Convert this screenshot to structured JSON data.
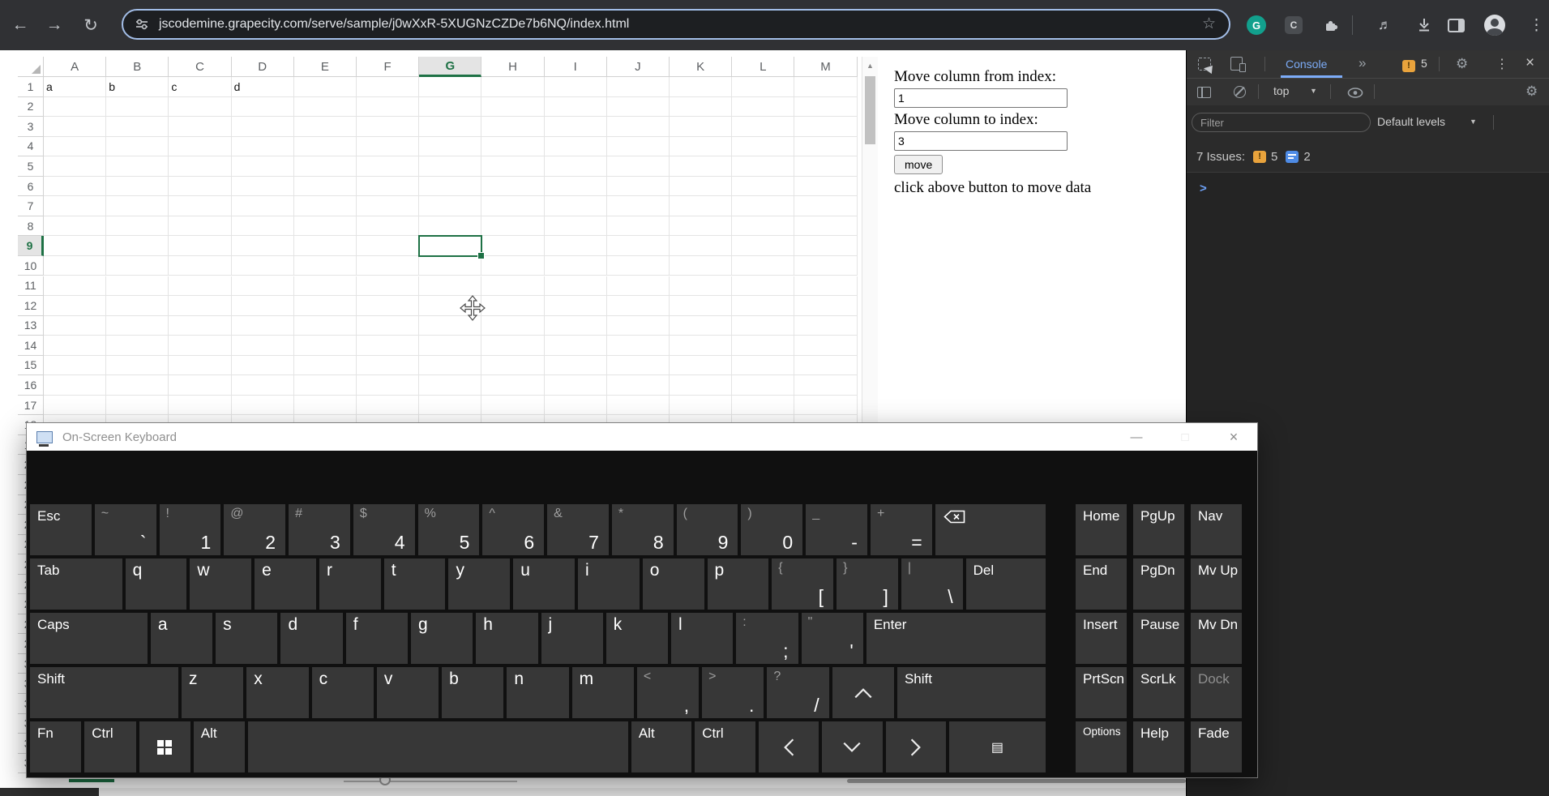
{
  "browser": {
    "url": "jscodemine.grapecity.com/serve/sample/j0wXxR-5XUGNzCZDe7b6NQ/index.html"
  },
  "icons": {
    "back": "←",
    "forward": "→",
    "reload": "↻",
    "bookmark_star": "☆",
    "grammarly_g": "G",
    "extension_c": "C",
    "media_note": "♬",
    "menu_dots": "⋮",
    "more_tabs": "»",
    "settings_gear": "⚙",
    "close_x": "×",
    "caret_down": "▼",
    "scroll_up_arrow": "▲",
    "osk_minimize": "—",
    "osk_maximize": "□",
    "osk_close": "×",
    "menu_key": "▤"
  },
  "colors": {
    "spreadsheet_accent": "#1e7145",
    "devtools_tab_blue": "#7cacf8",
    "warning_orange": "#e9a33c",
    "message_blue": "#4e8be5"
  },
  "spreadsheet": {
    "columns": [
      "A",
      "B",
      "C",
      "D",
      "E",
      "F",
      "G",
      "H",
      "I",
      "J",
      "K",
      "L",
      "M"
    ],
    "row_count": 36,
    "cells": [
      {
        "col": "A",
        "row": 1,
        "value": "a"
      },
      {
        "col": "B",
        "row": 1,
        "value": "b"
      },
      {
        "col": "C",
        "row": 1,
        "value": "c"
      },
      {
        "col": "D",
        "row": 1,
        "value": "d"
      }
    ],
    "selection": {
      "col": "G",
      "row": 9
    }
  },
  "controls": {
    "from_label": "Move column from index:",
    "from_value": "1",
    "to_label": "Move column to index:",
    "to_value": "3",
    "move_label": "move",
    "hint": "click above button to move data"
  },
  "devtools": {
    "tab": "Console",
    "tab_badge_count": "5",
    "context_selector": "top",
    "filter_placeholder": "Filter",
    "levels_selector": "Default levels",
    "issues_label": "7 Issues:",
    "issues_warning_count": "5",
    "issues_message_count": "2",
    "prompt": ">"
  },
  "osk": {
    "title": "On-Screen Keyboard",
    "rows": [
      [
        {
          "t": "mod",
          "l": "Esc"
        },
        {
          "t": "dual",
          "s": "~",
          "m": "`"
        },
        {
          "t": "dual",
          "s": "!",
          "m": "1"
        },
        {
          "t": "dual",
          "s": "@",
          "m": "2"
        },
        {
          "t": "dual",
          "s": "#",
          "m": "3"
        },
        {
          "t": "dual",
          "s": "$",
          "m": "4"
        },
        {
          "t": "dual",
          "s": "%",
          "m": "5"
        },
        {
          "t": "dual",
          "s": "^",
          "m": "6"
        },
        {
          "t": "dual",
          "s": "&",
          "m": "7"
        },
        {
          "t": "dual",
          "s": "*",
          "m": "8"
        },
        {
          "t": "dual",
          "s": "(",
          "m": "9"
        },
        {
          "t": "dual",
          "s": ")",
          "m": "0"
        },
        {
          "t": "dual",
          "s": "_",
          "m": "-"
        },
        {
          "t": "dual",
          "s": "+",
          "m": "="
        },
        {
          "t": "backspace",
          "w": 1.8
        }
      ],
      [
        {
          "t": "mod",
          "l": "Tab",
          "w": 1.5
        },
        {
          "t": "char",
          "l": "q"
        },
        {
          "t": "char",
          "l": "w"
        },
        {
          "t": "char",
          "l": "e"
        },
        {
          "t": "char",
          "l": "r"
        },
        {
          "t": "char",
          "l": "t"
        },
        {
          "t": "char",
          "l": "y"
        },
        {
          "t": "char",
          "l": "u"
        },
        {
          "t": "char",
          "l": "i"
        },
        {
          "t": "char",
          "l": "o"
        },
        {
          "t": "char",
          "l": "p"
        },
        {
          "t": "dual",
          "s": "{",
          "m": "["
        },
        {
          "t": "dual",
          "s": "}",
          "m": "]"
        },
        {
          "t": "dual",
          "s": "|",
          "m": "\\"
        },
        {
          "t": "mod",
          "l": "Del",
          "w": 1.3
        }
      ],
      [
        {
          "t": "mod",
          "l": "Caps",
          "w": 1.9
        },
        {
          "t": "char",
          "l": "a"
        },
        {
          "t": "char",
          "l": "s"
        },
        {
          "t": "char",
          "l": "d"
        },
        {
          "t": "char",
          "l": "f"
        },
        {
          "t": "char",
          "l": "g"
        },
        {
          "t": "char",
          "l": "h"
        },
        {
          "t": "char",
          "l": "j"
        },
        {
          "t": "char",
          "l": "k"
        },
        {
          "t": "char",
          "l": "l"
        },
        {
          "t": "dual",
          "s": ":",
          "m": ";"
        },
        {
          "t": "dual",
          "s": "\"",
          "m": "'"
        },
        {
          "t": "mod",
          "l": "Enter",
          "w": 2.9
        }
      ],
      [
        {
          "t": "mod",
          "l": "Shift",
          "w": 2.4
        },
        {
          "t": "char",
          "l": "z"
        },
        {
          "t": "char",
          "l": "x"
        },
        {
          "t": "char",
          "l": "c"
        },
        {
          "t": "char",
          "l": "v"
        },
        {
          "t": "char",
          "l": "b"
        },
        {
          "t": "char",
          "l": "n"
        },
        {
          "t": "char",
          "l": "m"
        },
        {
          "t": "dual",
          "s": "<",
          "m": ","
        },
        {
          "t": "dual",
          "s": ">",
          "m": "."
        },
        {
          "t": "dual",
          "s": "?",
          "m": "/"
        },
        {
          "t": "up"
        },
        {
          "t": "mod",
          "l": "Shift",
          "w": 2.4
        }
      ],
      [
        {
          "t": "mod",
          "l": "Fn",
          "w": 0.85
        },
        {
          "t": "mod",
          "l": "Ctrl",
          "w": 0.85
        },
        {
          "t": "win",
          "w": 0.85
        },
        {
          "t": "mod",
          "l": "Alt",
          "w": 0.85
        },
        {
          "t": "space",
          "w": 6.3
        },
        {
          "t": "mod",
          "l": "Alt"
        },
        {
          "t": "mod",
          "l": "Ctrl"
        },
        {
          "t": "left"
        },
        {
          "t": "down"
        },
        {
          "t": "right"
        },
        {
          "t": "menu",
          "w": 1.6
        }
      ]
    ],
    "nav": [
      [
        {
          "l": "Home"
        },
        {
          "l": "PgUp"
        },
        {
          "l": "Nav"
        }
      ],
      [
        {
          "l": "End"
        },
        {
          "l": "PgDn"
        },
        {
          "l": "Mv Up"
        }
      ],
      [
        {
          "l": "Insert"
        },
        {
          "l": "Pause"
        },
        {
          "l": "Mv Dn"
        }
      ],
      [
        {
          "l": "PrtScn"
        },
        {
          "l": "ScrLk"
        },
        {
          "l": "Dock",
          "dis": true
        }
      ],
      [
        {
          "l": "Options",
          "small": true
        },
        {
          "l": "Help"
        },
        {
          "l": "Fade"
        }
      ]
    ]
  }
}
